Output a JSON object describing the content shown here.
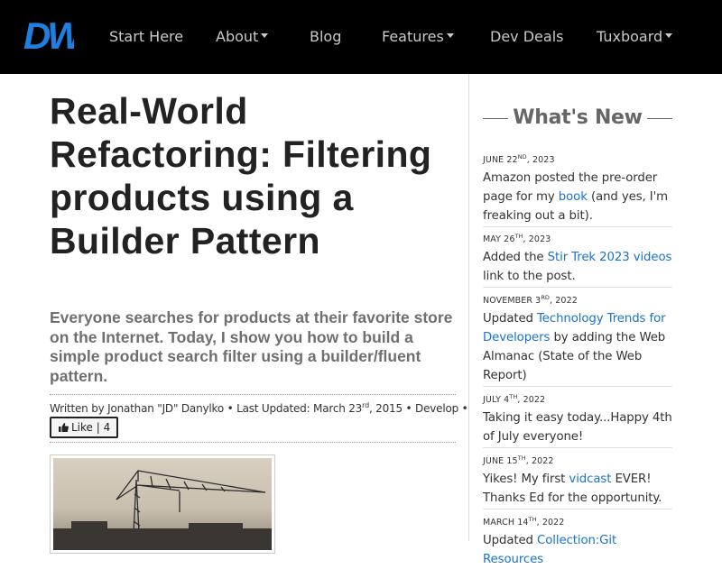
{
  "nav": {
    "logo_text": "DW",
    "items": [
      {
        "label": "Start Here",
        "dropdown": false
      },
      {
        "label": "About",
        "dropdown": true
      },
      {
        "label": "Blog",
        "dropdown": false
      },
      {
        "label": "Features",
        "dropdown": true
      },
      {
        "label": "Dev Deals",
        "dropdown": false
      },
      {
        "label": "Tuxboard",
        "dropdown": true
      }
    ]
  },
  "article": {
    "title": "Real-World Refactoring: Filtering products using a Builder Pattern",
    "subtitle": "Everyone searches for products at their favorite store on the Internet. Today, I show you how to build a simple product search filter using a builder/fluent pattern.",
    "byline": {
      "prefix": "Written by Jonathan \"JD\" Danylko • Last Updated: March 23",
      "date_suffix": "rd",
      "year": ", 2015 • Develop •"
    },
    "like": {
      "label": "Like | 4"
    }
  },
  "sidebar": {
    "heading": "What's New",
    "items": [
      {
        "date": "June 22",
        "suffix": "nd",
        "year": ", 2023",
        "before": "Amazon posted the pre-order page for my ",
        "link": "book",
        "after": " (and yes, I'm freaking out a bit)."
      },
      {
        "date": "May 26",
        "suffix": "th",
        "year": ", 2023",
        "before": "Added the ",
        "link": "Stir Trek 2023 videos",
        "after": " link to the post."
      },
      {
        "date": "November 3",
        "suffix": "rd",
        "year": ", 2022",
        "before": "Updated ",
        "link": "Technology Trends for Developers",
        "after": " by adding the Web Almanac (State of the Web Report)"
      },
      {
        "date": "July 4",
        "suffix": "th",
        "year": ", 2022",
        "before": "Taking it easy today...Happy 4th of July everyone!",
        "link": "",
        "after": ""
      },
      {
        "date": "June 15",
        "suffix": "th",
        "year": ", 2022",
        "before": "Yikes! My first ",
        "link": "vidcast",
        "after": " EVER! Thanks Ed for the opportunity."
      },
      {
        "date": "March 14",
        "suffix": "th",
        "year": ", 2022",
        "before": "Updated ",
        "link": "Collection:Git Resources",
        "after": ""
      }
    ]
  },
  "colors": {
    "nav_bg": "#000000",
    "nav_text": "#c9c9c9",
    "logo_blue": "#1e7fe0",
    "link": "#1a73c8",
    "subtitle": "#6f6f6f"
  }
}
